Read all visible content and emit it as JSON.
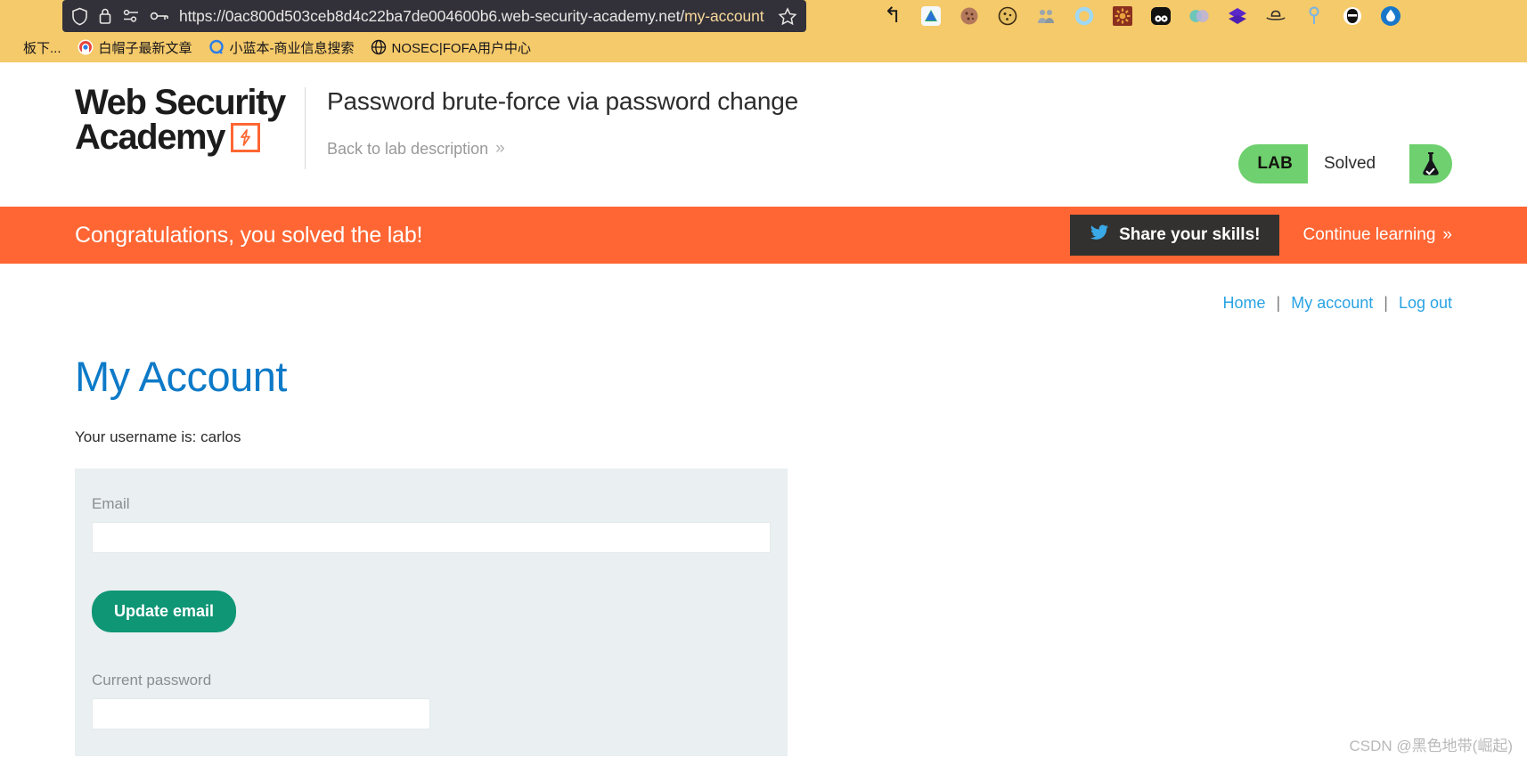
{
  "browser": {
    "url_prefix": "https://0ac800d503ceb8d4c22ba7de004600b6.web-security-academy.net/",
    "url_highlight": "my-account",
    "icons": {
      "shield": "shield-icon",
      "lock": "lock-icon",
      "permissions": "permissions-icon",
      "key": "key-icon",
      "bookmark_star": "star-icon"
    },
    "extensions": [
      {
        "name": "back-arrow-icon",
        "glyph": "↰",
        "color": "#1b1b1b"
      },
      {
        "name": "feedly-icon",
        "glyph": "▰",
        "color": "#2bb24c"
      },
      {
        "name": "cookie-brown-icon",
        "glyph": "●",
        "color": "#a9674a"
      },
      {
        "name": "cookie-editor-icon",
        "glyph": "◕",
        "color": "#caa14a"
      },
      {
        "name": "proxy-switchy-icon",
        "glyph": "♟",
        "color": "#9aa5ad"
      },
      {
        "name": "ring-icon",
        "glyph": "◯",
        "color": "#9fd8f2"
      },
      {
        "name": "sun-red-icon",
        "glyph": "✺",
        "color": "#8b2f1f"
      },
      {
        "name": "panda-icon",
        "glyph": "◖",
        "color": "#111111"
      },
      {
        "name": "venn-icon",
        "glyph": "◍",
        "color": "#6ec6b8"
      },
      {
        "name": "diamond-icon",
        "glyph": "◆",
        "color": "#5a27c8"
      },
      {
        "name": "hat-icon",
        "glyph": "⌂",
        "color": "#2b2b2b"
      },
      {
        "name": "pin-icon",
        "glyph": "⚲",
        "color": "#77b4e8"
      },
      {
        "name": "hacker-icon",
        "glyph": "☗",
        "color": "#111111"
      },
      {
        "name": "drop-icon",
        "glyph": "⬤",
        "color": "#1877c9"
      }
    ],
    "bookmarks": [
      {
        "label": "板下...",
        "icon": "folder-icon"
      },
      {
        "label": "白帽子最新文章",
        "icon": "hat-site-icon"
      },
      {
        "label": "小蓝本-商业信息搜索",
        "icon": "q-icon"
      },
      {
        "label": "NOSEC|FOFA用户中心",
        "icon": "globe-icon"
      }
    ]
  },
  "header": {
    "logo_line1": "Web Security",
    "logo_line2": "Academy",
    "logo_mark": "lightning-icon",
    "lab_title": "Password brute-force via password change",
    "back_link": "Back to lab description",
    "back_chevron": "»",
    "lab_badge": "LAB",
    "lab_state": "Solved",
    "flask_icon": "flask-check-icon"
  },
  "banner": {
    "message": "Congratulations, you solved the lab!",
    "share_label": "Share your skills!",
    "share_icon": "twitter-icon",
    "continue_label": "Continue learning",
    "continue_chevron": "»",
    "bg_color": "#ff6633"
  },
  "account_nav": [
    {
      "label": "Home"
    },
    {
      "label": "My account"
    },
    {
      "label": "Log out"
    }
  ],
  "nav_separator": "|",
  "main": {
    "title": "My Account",
    "username_line": "Your username is: carlos",
    "email_label": "Email",
    "email_value": "",
    "update_email_button": "Update email",
    "current_password_label": "Current password",
    "current_password_value": ""
  },
  "watermark": "CSDN @黑色地带(崛起)",
  "colors": {
    "chrome_bg": "#f5ca6a",
    "urlbar_bg": "#32313a",
    "accent_orange": "#ff6633",
    "link_blue": "#29a3e3",
    "title_blue": "#0d7ac8",
    "button_green": "#0f9675",
    "lab_green": "#6ed06e",
    "panel_grey": "#eaeff1"
  }
}
